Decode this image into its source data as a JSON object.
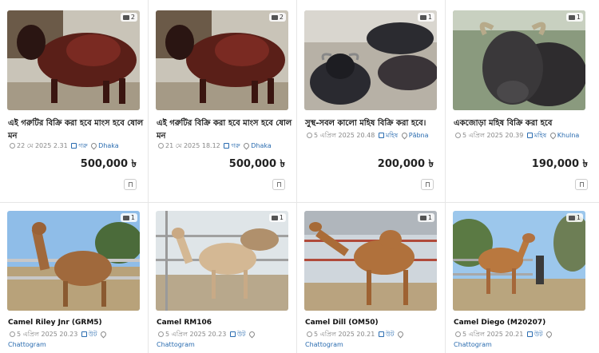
{
  "listings": [
    {
      "title": "এই গরুটির বিক্রি করা হবে মাংস হবে ষোল মন",
      "date": "22 মে 2025 2.31",
      "category": "গরু",
      "location": "Dhaka",
      "price": "500,000 ৳",
      "photos": "2"
    },
    {
      "title": "এই গরুটির বিক্রি করা হবে মাংস হবে ষোল মন",
      "date": "21 মে 2025 18.12",
      "category": "গরু",
      "location": "Dhaka",
      "price": "500,000 ৳",
      "photos": "2"
    },
    {
      "title": "সুস্থ-সবল কালো মহিষ বিক্রি করা হবে।",
      "date": "5 এপ্রিল 2025 20.48",
      "category": "মহিষ",
      "location": "Pābna",
      "price": "200,000 ৳",
      "photos": "1"
    },
    {
      "title": "একজোড়া মহিষ বিক্রি করা হবে",
      "date": "5 এপ্রিল 2025 20.39",
      "category": "মহিষ",
      "location": "Khulna",
      "price": "190,000 ৳",
      "photos": "1"
    },
    {
      "title": "Camel Riley Jnr (GRM5)",
      "date": "5 এপ্রিল 2025 20.23",
      "category": "উট",
      "location": "Chattogram",
      "photos": "1"
    },
    {
      "title": "Camel RM106",
      "date": "5 এপ্রিল 2025 20.23",
      "category": "উট",
      "location": "Chattogram",
      "photos": "1"
    },
    {
      "title": "Camel Dill (OM50)",
      "date": "5 এপ্রিল 2025 20.21",
      "category": "উট",
      "location": "Chattogram",
      "photos": "1"
    },
    {
      "title": "Camel Diego (M20207)",
      "date": "5 এপ্রিল 2025 20.21",
      "category": "উট",
      "location": "Chattogram",
      "photos": "1"
    }
  ]
}
